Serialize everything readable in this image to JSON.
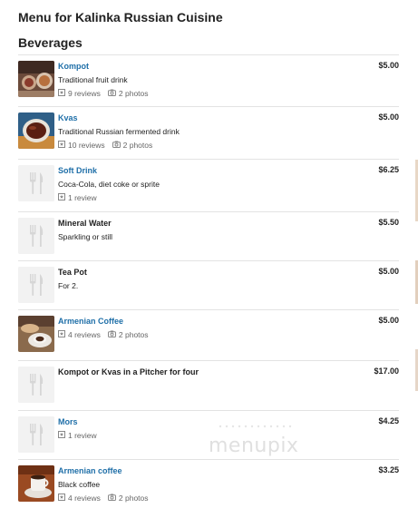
{
  "page": {
    "title": "Menu for Kalinka Russian Cuisine",
    "section": "Beverages",
    "watermark": "menupix"
  },
  "items": [
    {
      "name": "Kompot",
      "description": "Traditional fruit drink",
      "price": "$5.00",
      "reviews": "9 reviews",
      "photos": "2 photos",
      "thumb": "photo"
    },
    {
      "name": "Kvas",
      "description": "Traditional Russian fermented drink",
      "price": "$5.00",
      "reviews": "10 reviews",
      "photos": "2 photos",
      "thumb": "photo"
    },
    {
      "name": "Soft Drink",
      "description": "Coca-Cola, diet coke or sprite",
      "price": "$6.25",
      "reviews": "1 review",
      "photos": "",
      "thumb": "placeholder"
    },
    {
      "name": "Mineral Water",
      "description": "Sparkling or still",
      "price": "$5.50",
      "reviews": "",
      "photos": "",
      "thumb": "placeholder"
    },
    {
      "name": "Tea Pot",
      "description": "For 2.",
      "price": "$5.00",
      "reviews": "",
      "photos": "",
      "thumb": "placeholder"
    },
    {
      "name": "Armenian Coffee",
      "description": "",
      "price": "$5.00",
      "reviews": "4 reviews",
      "photos": "2 photos",
      "thumb": "photo"
    },
    {
      "name": "Kompot or Kvas in a Pitcher for four",
      "description": "",
      "price": "$17.00",
      "reviews": "",
      "photos": "",
      "thumb": "placeholder"
    },
    {
      "name": "Mors",
      "description": "",
      "price": "$4.25",
      "reviews": "1 review",
      "photos": "",
      "thumb": "placeholder"
    },
    {
      "name": "Armenian coffee",
      "description": "Black coffee",
      "price": "$3.25",
      "reviews": "4 reviews",
      "photos": "2 photos",
      "thumb": "photo"
    }
  ]
}
